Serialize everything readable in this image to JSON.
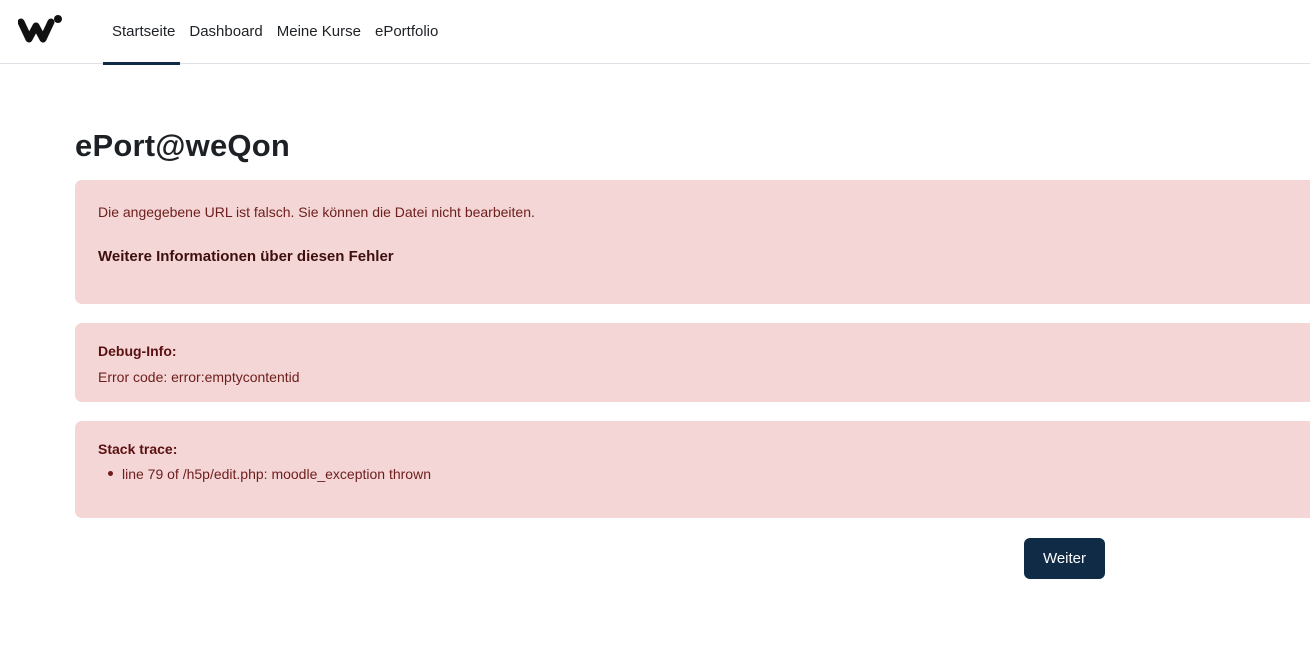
{
  "logo": {
    "icon": "w-logo-icon"
  },
  "nav": {
    "items": [
      {
        "label": "Startseite",
        "active": true
      },
      {
        "label": "Dashboard",
        "active": false
      },
      {
        "label": "Meine Kurse",
        "active": false
      },
      {
        "label": "ePortfolio",
        "active": false
      }
    ]
  },
  "page": {
    "title": "ePort@weQon"
  },
  "error": {
    "message": "Die angegebene URL ist falsch. Sie können die Datei nicht bearbeiten.",
    "more_info_link": "Weitere Informationen über diesen Fehler"
  },
  "debug": {
    "heading": "Debug-Info:",
    "text": "Error code: error:emptycontentid"
  },
  "stack": {
    "heading": "Stack trace:",
    "items": [
      "line 79 of /h5p/edit.php: moodle_exception thrown"
    ]
  },
  "actions": {
    "continue_label": "Weiter"
  },
  "colors": {
    "brand": "#0f2b46",
    "alert_bg": "#f3d6d5",
    "alert_text": "#6e1d1d"
  }
}
